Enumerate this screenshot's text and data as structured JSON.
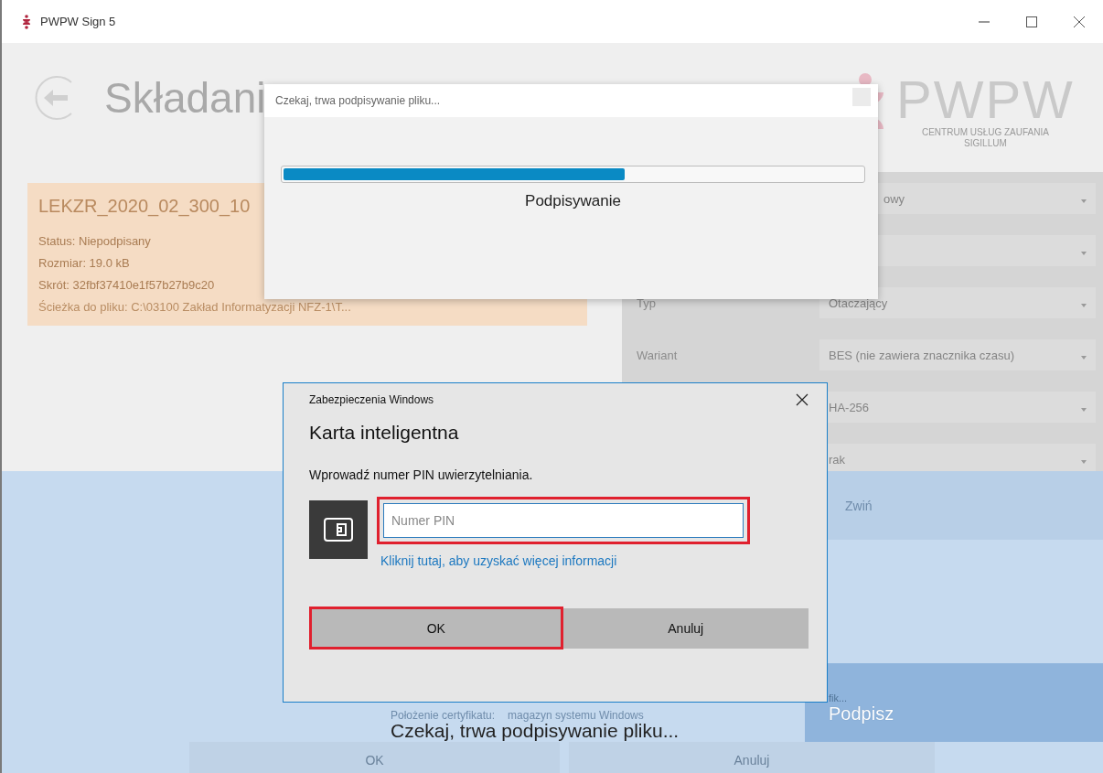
{
  "window": {
    "title": "PWPW Sign 5"
  },
  "page": {
    "heading": "Składani"
  },
  "file_card": {
    "name": "LEKZR_2020_02_300_10",
    "lines": [
      "Status: Niepodpisany",
      "Rozmiar: 19.0 kB",
      "Skrót: 32fbf37410e1f57b27b9c20",
      "Ścieżka do pliku: C:\\03100 Zakład Informatyzacji NFZ-1\\T..."
    ]
  },
  "logo": {
    "brand": "PWPW",
    "subtitle_1": "CENTRUM USŁUG ZAUFANIA",
    "subtitle_2": "SIGILLUM"
  },
  "settings": [
    {
      "kind": "dropdown",
      "value": "owy"
    },
    {
      "kind": "dropdown"
    },
    {
      "kind": "dropdown",
      "label": "Typ",
      "value": "Otaczający"
    },
    {
      "kind": "dropdown",
      "label": "Wariant",
      "value": "BES (nie zawiera znacznika czasu)"
    },
    {
      "kind": "dropdown",
      "value": "HA-256"
    },
    {
      "kind": "dropdown",
      "value": "rak"
    }
  ],
  "collapse_button": "Zwiń",
  "certificate": {
    "fragment": "fik...",
    "location_label": "Położenie certyfikatu:",
    "location_value": "magazyn systemu Windows"
  },
  "sign_button": "Podpisz",
  "status_text": "Czekaj, trwa podpisywanie pliku...",
  "footer_buttons": [
    "OK",
    "Anuluj"
  ],
  "progress_dialog": {
    "title": "Czekaj, trwa podpisywanie pliku...",
    "level": 0.59,
    "label": "Podpisywanie"
  },
  "security_dialog": {
    "caption": "Zabezpieczenia Windows",
    "heading": "Karta inteligentna",
    "prompt": "Wprowadź numer PIN uwierzytelniania.",
    "pin_field": {
      "placeholder": "Numer PIN",
      "highlighted": true
    },
    "link": "Kliknij tutaj, aby uzyskać więcej informacji",
    "buttons": [
      {
        "label": "OK",
        "highlighted": true
      },
      {
        "label": "Anuluj",
        "highlighted": false
      }
    ]
  }
}
